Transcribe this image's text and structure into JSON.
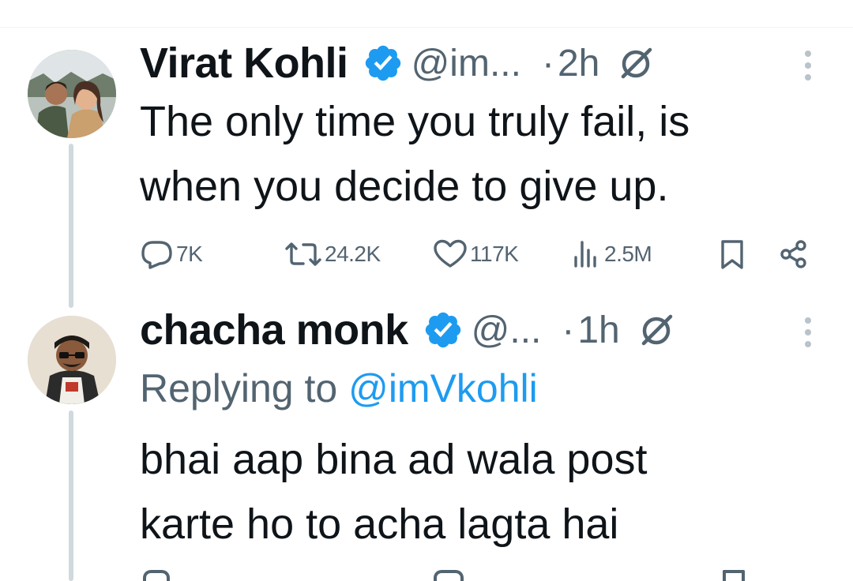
{
  "colors": {
    "text": "#0f1419",
    "secondary": "#536471",
    "verified_blue": "#1d9bf0",
    "mention_blue": "#1d9bf0",
    "thread_line": "#cfd9de"
  },
  "tweets": [
    {
      "name": "Virat Kohli",
      "handle": "@im...",
      "separator": "·",
      "time": "2h",
      "text_lines": [
        "The only time you truly fail, is",
        "when you decide to give up."
      ],
      "actions": {
        "replies": "7K",
        "reposts": "24.2K",
        "likes": "117K",
        "views": "2.5M"
      }
    },
    {
      "name": "chacha monk",
      "handle": "@...",
      "separator": "·",
      "time": "1h",
      "replying_prefix": "Replying to",
      "replying_to": "@imVkohli",
      "text_lines": [
        "bhai aap bina ad wala post",
        "karte ho to acha lagta hai"
      ]
    }
  ],
  "icons": {
    "verified": "verified-badge-icon",
    "grok": "grok-icon",
    "more": "more-vertical-icon",
    "reply": "reply-icon",
    "repost": "repost-icon",
    "like": "heart-icon",
    "views": "views-chart-icon",
    "bookmark": "bookmark-icon",
    "share": "share-icon"
  }
}
